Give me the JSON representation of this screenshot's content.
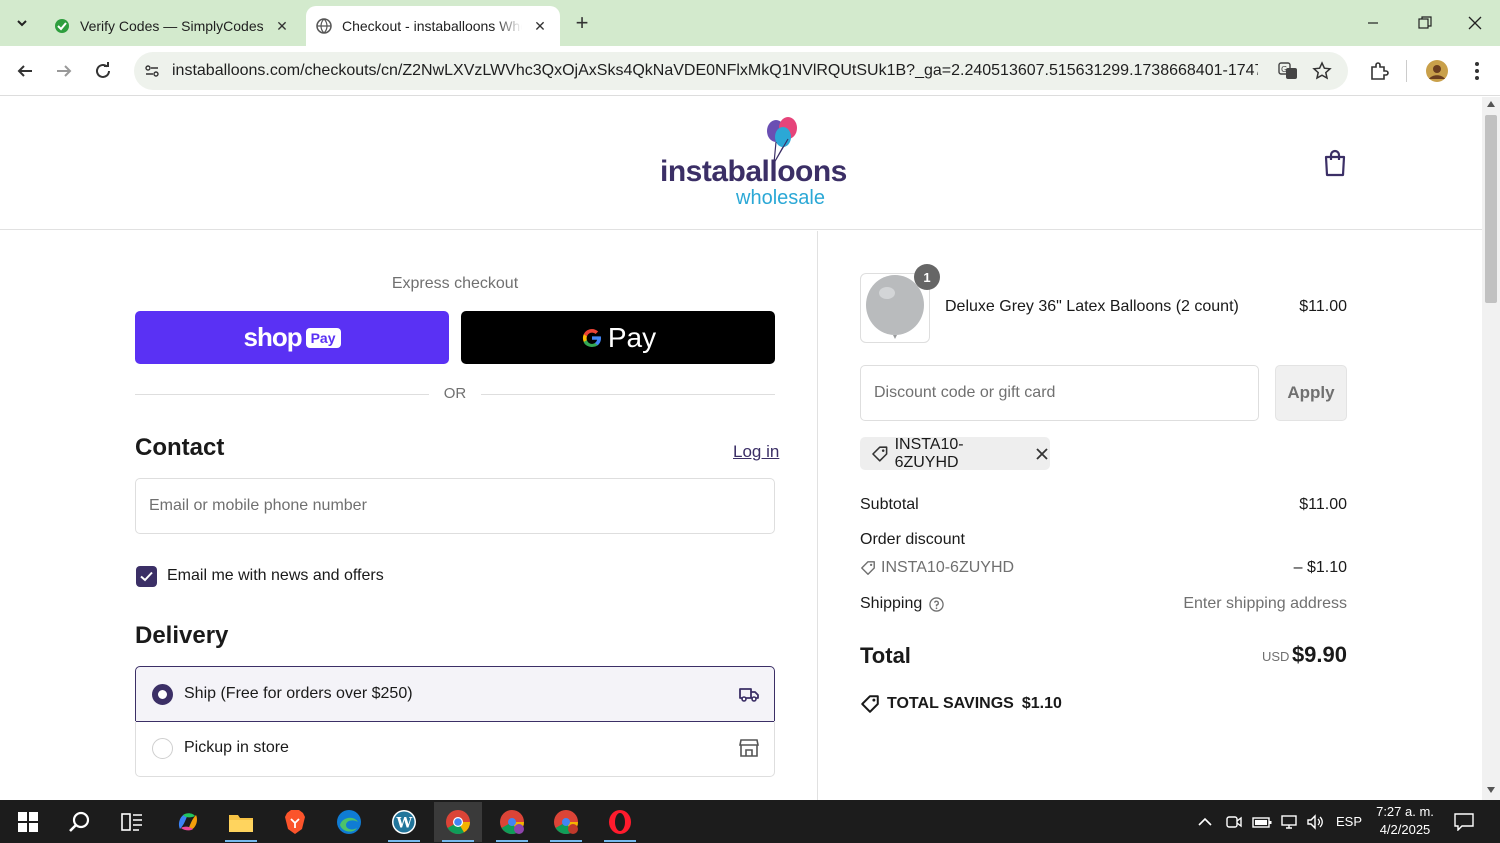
{
  "browser": {
    "tabs": [
      {
        "title": "Verify Codes — SimplyCodes",
        "active": false
      },
      {
        "title": "Checkout - instaballoons Whole",
        "active": true
      }
    ],
    "url": "instaballoons.com/checkouts/cn/Z2NwLXVzLWVhc3QxOjAxSks4QkNaVDE0NFlxMkQ1NVlRQUtSUk1B?_ga=2.240513607.515631299.1738668401-1747757956.1..."
  },
  "header": {
    "logo_word1": "instaballoons",
    "logo_word2": "wholesale"
  },
  "checkout": {
    "express_label": "Express checkout",
    "shop_pay_word": "shop",
    "shop_pay_pill": "Pay",
    "gpay_label": "Pay",
    "or_label": "OR",
    "contact_heading": "Contact",
    "login_label": "Log in",
    "email_placeholder": "Email or mobile phone number",
    "news_label": "Email me with news and offers",
    "delivery_heading": "Delivery",
    "options": [
      {
        "label": "Ship (Free for orders over $250)",
        "selected": true
      },
      {
        "label": "Pickup in store",
        "selected": false
      }
    ]
  },
  "summary": {
    "item": {
      "qty": "1",
      "name": "Deluxe Grey 36\" Latex Balloons (2 count)",
      "price": "$11.00"
    },
    "discount_placeholder": "Discount code or gift card",
    "apply_label": "Apply",
    "applied_code": "INSTA10-6ZUYHD",
    "subtotal_label": "Subtotal",
    "subtotal_value": "$11.00",
    "order_discount_label": "Order discount",
    "discount_code": "INSTA10-6ZUYHD",
    "discount_value": "– $1.10",
    "shipping_label": "Shipping",
    "shipping_value": "Enter shipping address",
    "total_label": "Total",
    "currency": "USD",
    "total_value": "$9.90",
    "savings_label": "TOTAL SAVINGS",
    "savings_value": "$1.10"
  },
  "taskbar": {
    "lang": "ESP",
    "time": "7:27 a. m.",
    "date": "4/2/2025"
  },
  "colors": {
    "brand": "#3b2f66",
    "shop_pay": "#5a31f4",
    "tabstrip": "#d3eacd"
  }
}
